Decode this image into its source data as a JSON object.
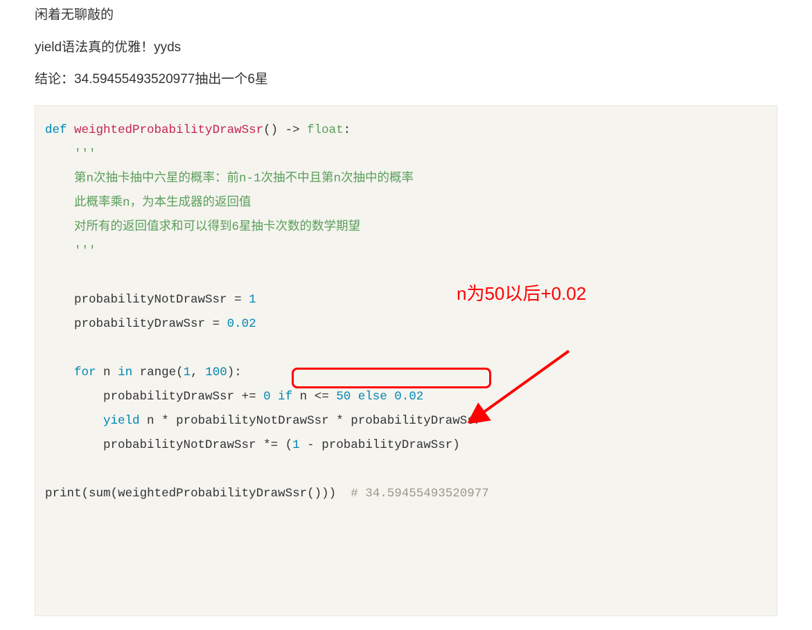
{
  "prose": {
    "line1": "闲着无聊敲的",
    "line2": "yield语法真的优雅！yyds",
    "line3": "结论：34.59455493520977抽出一个6星"
  },
  "annotation": {
    "label": "n为50以后+0.02"
  },
  "code": {
    "kw_def": "def",
    "fn_name": "weightedProbabilityDrawSsr",
    "arrow": "->",
    "ret_type": "float",
    "colon": ":",
    "triple_quote": "'''",
    "doc1": "第n次抽卡抽中六星的概率：前n-1次抽不中且第n次抽中的概率",
    "doc2": "此概率乘n，为本生成器的返回值",
    "doc3": "对所有的返回值求和可以得到6星抽卡次数的数学期望",
    "var_notdraw": "probabilityNotDrawSsr",
    "eq": "=",
    "one": "1",
    "var_draw": "probabilityDrawSsr",
    "p002": "0.02",
    "kw_for": "for",
    "var_n": "n",
    "kw_in": "in",
    "fn_range": "range",
    "lp": "(",
    "cm": ",",
    "a1": "1",
    "a100": "100",
    "rp": ")",
    "pluseq": "+=",
    "zero": "0",
    "kw_if": "if",
    "le": "<=",
    "fifty": "50",
    "kw_else": "else",
    "kw_yield": "yield",
    "star": "*",
    "stareq": "*=",
    "minus": "-",
    "fn_print": "print",
    "fn_sum": "sum",
    "comment_result": "# 34.59455493520977"
  }
}
